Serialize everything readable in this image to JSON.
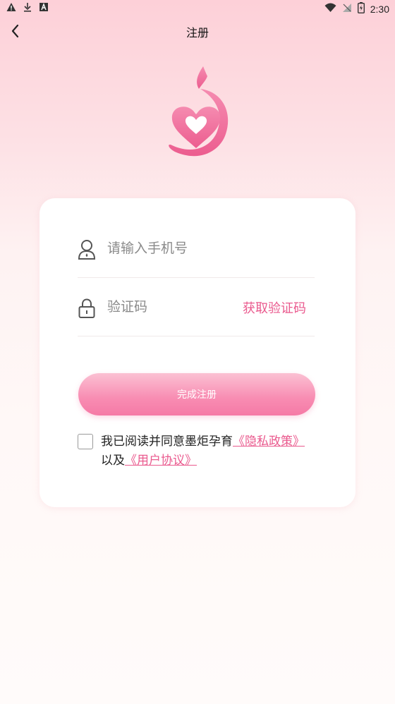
{
  "status_bar": {
    "time": "2:30",
    "left_icons": [
      "warning-icon",
      "download-icon",
      "font-icon"
    ],
    "right_icons": [
      "wifi-icon",
      "no-signal-icon",
      "battery-icon"
    ]
  },
  "nav": {
    "title": "注册",
    "back_icon": "chevron-left-icon"
  },
  "logo": {
    "icon": "heart-flame-logo",
    "color": "#f06292"
  },
  "form": {
    "phone": {
      "placeholder": "请输入手机号",
      "value": "",
      "icon": "user-icon"
    },
    "code": {
      "placeholder": "验证码",
      "value": "",
      "icon": "lock-icon",
      "get_code_label": "获取验证码"
    },
    "submit_label": "完成注册",
    "agreement": {
      "checked": false,
      "prefix": "我已阅读并同意墨炬孕育",
      "privacy_link": "《隐私政策》",
      "middle": "以及",
      "terms_link": "《用户协议》"
    }
  },
  "colors": {
    "accent": "#ea5a8e",
    "button_top": "#fbc1d3",
    "button_bottom": "#f57aa6",
    "background_top": "#fdd0d8"
  }
}
